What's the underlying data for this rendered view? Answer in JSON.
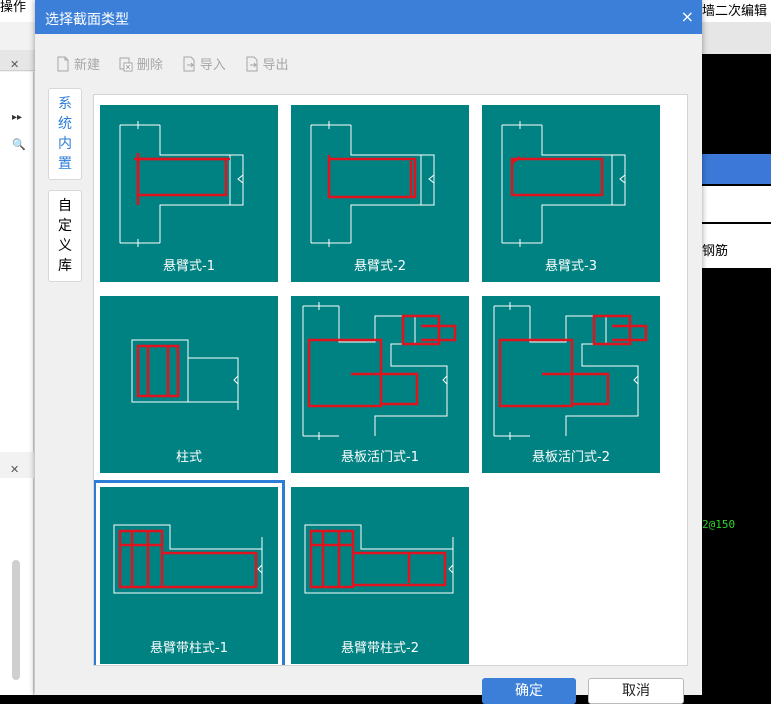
{
  "background": {
    "left_menu_label": "操作",
    "right_menu_label": "墙二次编辑",
    "right_panel_text": "钢筋",
    "right_green_text": "2@150"
  },
  "dialog": {
    "title": "选择截面类型",
    "close_glyph": "×"
  },
  "toolbar": {
    "new_label": "新建",
    "delete_label": "删除",
    "import_label": "导入",
    "export_label": "导出"
  },
  "tabs": {
    "builtin": [
      "系",
      "统",
      "内",
      "置"
    ],
    "custom": [
      "自",
      "定",
      "义",
      "库"
    ]
  },
  "sections": [
    {
      "label": "悬臂式-1",
      "selected": false
    },
    {
      "label": "悬臂式-2",
      "selected": false
    },
    {
      "label": "悬臂式-3",
      "selected": false
    },
    {
      "label": "柱式",
      "selected": false
    },
    {
      "label": "悬板活门式-1",
      "selected": false
    },
    {
      "label": "悬板活门式-2",
      "selected": false
    },
    {
      "label": "悬臂带柱式-1",
      "selected": true
    },
    {
      "label": "悬臂带柱式-2",
      "selected": false
    }
  ],
  "footer": {
    "ok_label": "确定",
    "cancel_label": "取消"
  },
  "colors": {
    "tile_bg": "#008282",
    "rebar": "#e0141e",
    "accent": "#2d7cd6"
  }
}
